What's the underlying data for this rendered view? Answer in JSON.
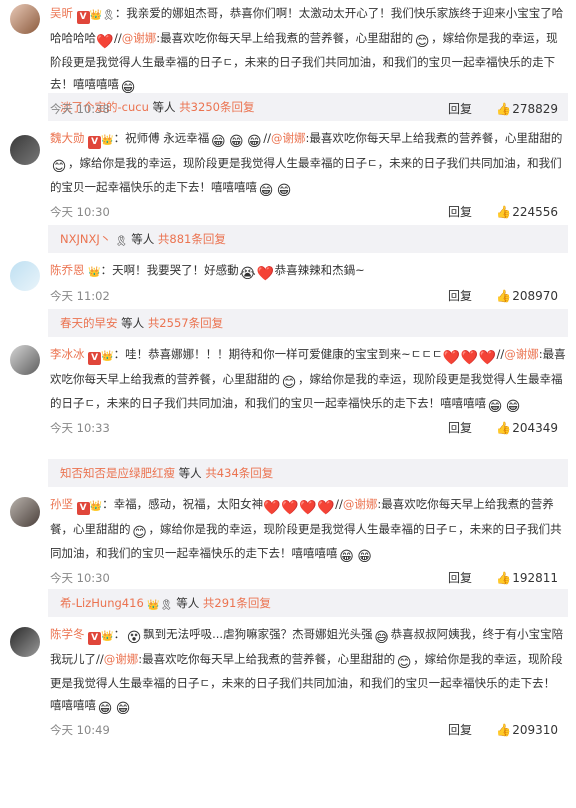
{
  "common": {
    "reply_label": "回复",
    "more_text": "等人",
    "ribbon": "🎗",
    "mouth": "💋"
  },
  "comments": [
    {
      "user": "吴昕",
      "segments": [
        "：我亲爱的娜姐杰哥，恭喜你们啊！太激动太开心了！我们快乐家族终于迎来小宝宝了哈哈哈哈哈",
        "//",
        "@谢娜",
        ":最喜欢吃你每天早上给我煮的营养餐，心里甜甜的",
        "，嫁给你是我的幸运，现阶段更是我觉得人生最幸福的日子ㄷ，未来的日子我们共同加油，和我们的宝贝一起幸福快乐的走下去！嘻嘻嘻嘻"
      ],
      "time": "今天 10:38",
      "likes": "278829",
      "sub": {
        "users": "淡了个定的-cucu",
        "count": "共3250条回复"
      }
    },
    {
      "user": "魏大勋",
      "segments": [
        "：祝师傅 永远幸福",
        "//",
        "@谢娜",
        ":最喜欢吃你每天早上给我煮的营养餐，心里甜甜的",
        "，嫁给你是我的幸运，现阶段更是我觉得人生最幸福的日子ㄷ，未来的日子我们共同加油，和我们的宝贝一起幸福快乐的走下去！嘻嘻嘻嘻"
      ],
      "time": "今天 10:30",
      "likes": "224556",
      "sub": {
        "users": "NXJNXJ丶",
        "count": "共881条回复"
      }
    },
    {
      "user": "陈乔恩",
      "segments": [
        "：天啊！我要哭了！好感動",
        "恭喜辣辣和杰鍋~"
      ],
      "time": "今天 11:02",
      "likes": "208970",
      "sub": {
        "users": "春天的早安",
        "count": "共2557条回复"
      }
    },
    {
      "user": "李冰冰",
      "segments": [
        "：哇！恭喜娜娜！！！期待和你一样可爱健康的宝宝到来~ㄷㄷㄷ",
        "//",
        "@谢娜",
        ":最喜欢吃你每天早上给我煮的营养餐，心里甜甜的",
        "，嫁给你是我的幸运，现阶段更是我觉得人生最幸福的日子ㄷ，未来的日子我们共同加油，和我们的宝贝一起幸福快乐的走下去！嘻嘻嘻嘻"
      ],
      "time": "今天 10:33",
      "likes": "204349",
      "sub": {
        "users": "知否知否是应绿肥红瘦",
        "count": "共434条回复"
      }
    },
    {
      "user": "孙坚",
      "segments": [
        "：幸福，感动，祝福，太阳女神",
        "//",
        "@谢娜",
        ":最喜欢吃你每天早上给我煮的营养餐，心里甜甜的",
        "，嫁给你是我的幸运，现阶段更是我觉得人生最幸福的日子ㄷ，未来的日子我们共同加油，和我们的宝贝一起幸福快乐的走下去！嘻嘻嘻嘻"
      ],
      "time": "今天 10:30",
      "likes": "192811",
      "sub": {
        "users": "希-LizHung416",
        "count": "共291条回复"
      }
    },
    {
      "user": "陈学冬",
      "segments": [
        "：",
        "飘到无法呼吸...虐狗嘛家强？杰哥娜姐光头强",
        "恭喜叔叔阿姨我，终于有小宝宝陪我玩儿了",
        "//",
        "@谢娜",
        ":最喜欢吃你每天早上给我煮的营养餐，心里甜甜的",
        "，嫁给你是我的幸运，现阶段更是我觉得人生最幸福的日子ㄷ，未来的日子我们共同加油，和我们的宝贝一起幸福快乐的走下去！嘻嘻嘻嘻"
      ],
      "time": "今天 10:49",
      "likes": "209310"
    }
  ]
}
